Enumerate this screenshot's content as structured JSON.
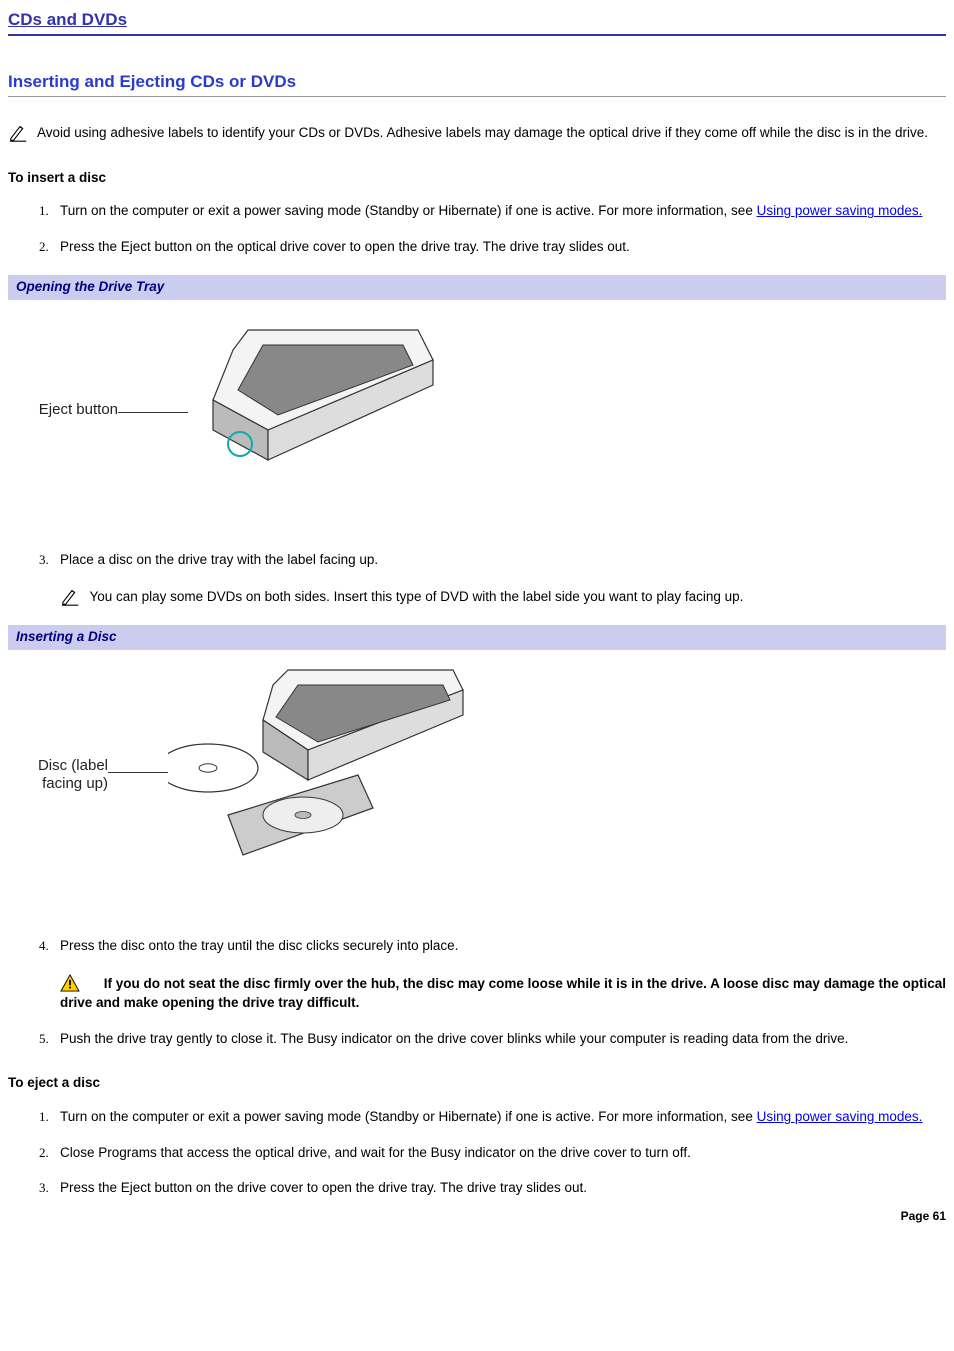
{
  "toc_heading": "CDs and DVDs",
  "section_heading": "Inserting and Ejecting CDs or DVDs",
  "top_note": "Avoid using adhesive labels to identify your CDs or DVDs. Adhesive labels may damage the optical drive if they come off while the disc is in the drive.",
  "insert": {
    "heading": "To insert a disc",
    "steps": {
      "s1a": "Turn on the computer or exit a power saving mode (Standby or Hibernate) if one is active. For more information, see ",
      "s1_link": "Using power saving modes.",
      "s2": "Press the Eject button on the optical drive cover to open the drive tray. The drive tray slides out.",
      "s3": "Place a disc on the drive tray with the label facing up.",
      "s3_note": "You can play some DVDs on both sides. Insert this type of DVD with the label side you want to play facing up.",
      "s4": "Press the disc onto the tray until the disc clicks securely into place.",
      "s4_warn": "If you do not seat the disc firmly over the hub, the disc may come loose while it is in the drive. A loose disc may damage the optical drive and make opening the drive tray difficult.",
      "s5": "Push the drive tray gently to close it. The Busy indicator on the drive cover blinks while your computer is reading data from the drive."
    }
  },
  "figures": {
    "f1_caption": "Opening the Drive Tray",
    "f1_label": "Eject button",
    "f2_caption": "Inserting a Disc",
    "f2_label_l1": "Disc (label",
    "f2_label_l2": "facing up)"
  },
  "eject": {
    "heading": "To eject a disc",
    "steps": {
      "s1a": "Turn on the computer or exit a power saving mode (Standby or Hibernate) if one is active. For more information, see ",
      "s1_link": "Using power saving modes.",
      "s2": "Close Programs that access the optical drive, and wait for the Busy indicator on the drive cover to turn off.",
      "s3": "Press the Eject button on the drive cover to open the drive tray. The drive tray slides out."
    }
  },
  "page_footer": "Page 61"
}
